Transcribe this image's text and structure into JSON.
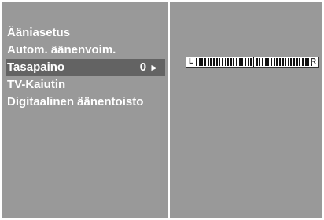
{
  "menu": {
    "items": [
      {
        "label": "Ääniasetus"
      },
      {
        "label": "Autom. äänenvoim."
      },
      {
        "label": "Tasapaino",
        "value": "0",
        "arrow": "►",
        "selected": true
      },
      {
        "label": "TV-Kaiutin"
      },
      {
        "label": "Digitaalinen äänentoisto"
      }
    ]
  },
  "balance": {
    "left_label": "L",
    "right_label": "R",
    "value": 0,
    "range": [
      -20,
      20
    ]
  },
  "colors": {
    "panel": "#999999",
    "selected": "#636363",
    "text": "#ffffff"
  },
  "icons": {
    "submenu_arrow": "right-triangle-icon"
  }
}
